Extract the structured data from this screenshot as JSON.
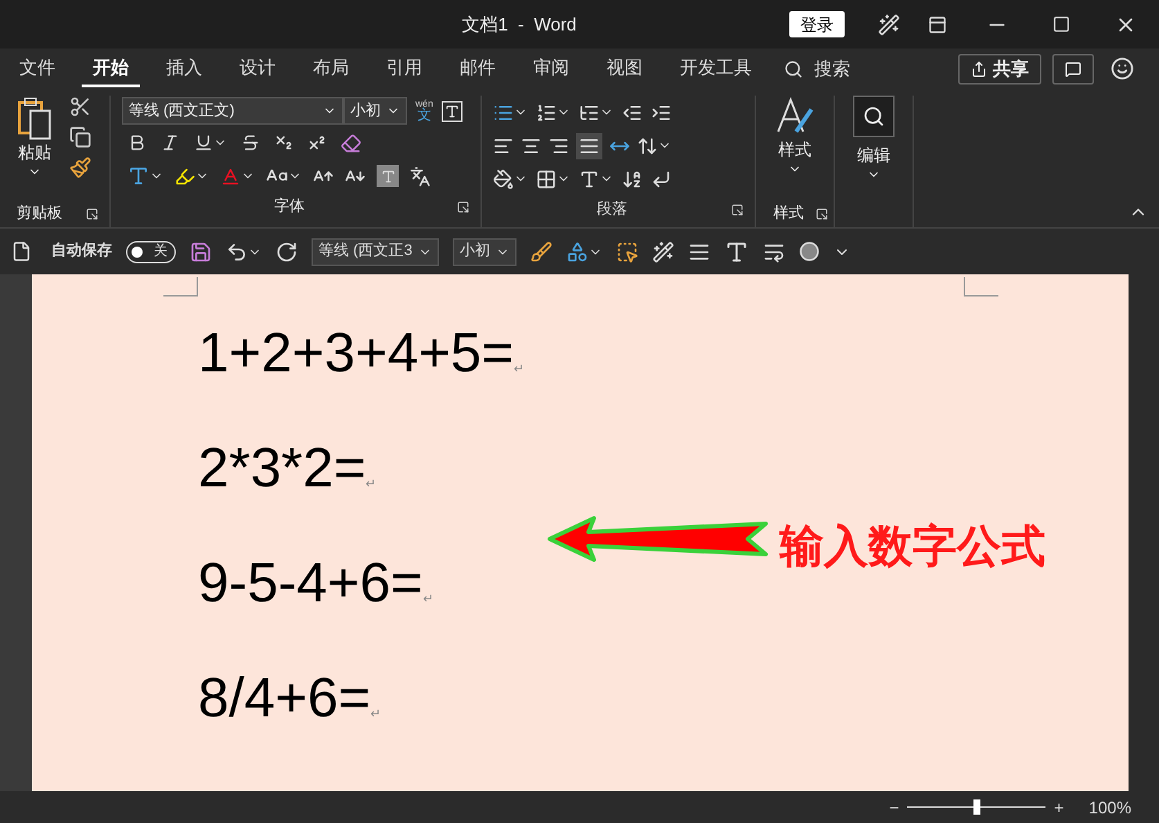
{
  "window": {
    "title": "文档1  -  Word",
    "sign_in": "登录"
  },
  "tabs": [
    {
      "label": "文件",
      "selected": false
    },
    {
      "label": "开始",
      "selected": true
    },
    {
      "label": "插入",
      "selected": false
    },
    {
      "label": "设计",
      "selected": false
    },
    {
      "label": "布局",
      "selected": false
    },
    {
      "label": "引用",
      "selected": false
    },
    {
      "label": "邮件",
      "selected": false
    },
    {
      "label": "审阅",
      "selected": false
    },
    {
      "label": "视图",
      "selected": false
    },
    {
      "label": "开发工具",
      "selected": false
    }
  ],
  "search": {
    "label": "搜索"
  },
  "share": {
    "label": "共享"
  },
  "ribbon": {
    "clipboard": {
      "paste": "粘贴",
      "group": "剪贴板"
    },
    "font": {
      "font_name": "等线 (西文正文)",
      "font_size": "小初",
      "phonetic_top": "wén",
      "phonetic_bottom": "文",
      "group": "字体"
    },
    "paragraph": {
      "group": "段落",
      "justify_selected": true
    },
    "styles": {
      "label": "样式",
      "group": "样式"
    },
    "editing": {
      "label": "编辑"
    }
  },
  "quick_access": {
    "autosave": "自动保存",
    "autosave_on": false,
    "autosave_state": "关",
    "font_name": "等线 (西文正3",
    "font_size": "小初"
  },
  "document": {
    "lines": [
      "1+2+3+4+5=",
      "2*3*2=",
      "9-5-4+6=",
      "8/4+6="
    ],
    "paragraph_mark": "↵"
  },
  "annotation": {
    "text": "输入数字公式"
  },
  "status_bar": {
    "zoom_minus": "−",
    "zoom_plus": "+",
    "zoom": "100%",
    "level": 0.5
  }
}
